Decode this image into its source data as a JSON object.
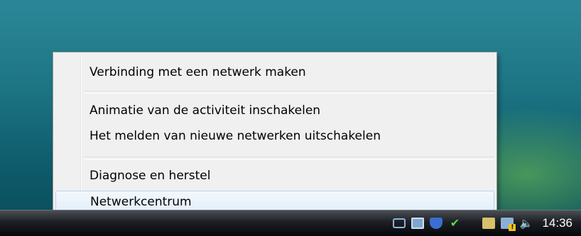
{
  "context_menu": {
    "items": [
      {
        "label": "Verbinding met een netwerk maken"
      },
      {
        "label": "Animatie van de activiteit inschakelen"
      },
      {
        "label": "Het melden van nieuwe netwerken uitschakelen"
      },
      {
        "label": "Diagnose en herstel"
      },
      {
        "label": "Netwerkcentrum"
      }
    ],
    "highlighted_item": "Netwerkcentrum"
  },
  "taskbar": {
    "tray_icons": [
      "network-icon",
      "monitor-icon",
      "shield-icon",
      "checkmark-icon",
      "folder-icon",
      "network-warning-icon",
      "speaker-icon"
    ],
    "clock": "14:36"
  },
  "colors": {
    "menu_background": "#f0f0f0",
    "hover_border": "#b7d3ee",
    "taskbar": "#1c1f24"
  }
}
